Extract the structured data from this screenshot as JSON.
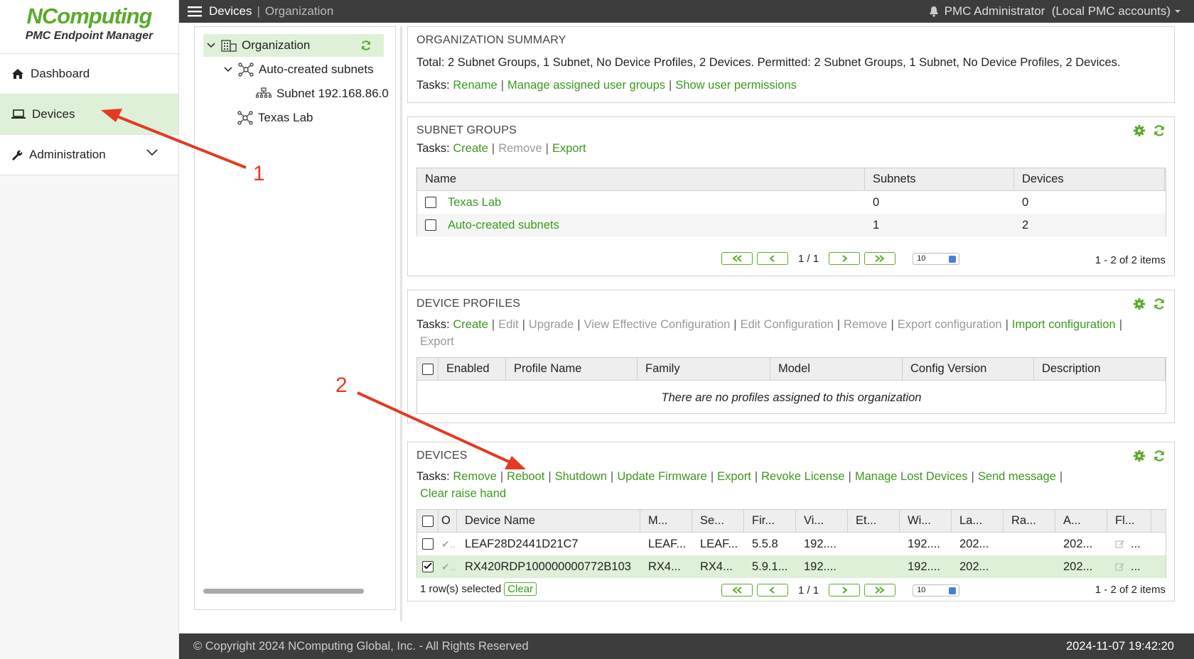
{
  "app": {
    "brand": "NComputing",
    "subtitle": "PMC Endpoint Manager"
  },
  "sidebar": {
    "items": [
      {
        "label": "Dashboard",
        "icon": "home-icon"
      },
      {
        "label": "Devices",
        "icon": "laptop-icon",
        "active": true
      },
      {
        "label": "Administration",
        "icon": "wrench-icon"
      }
    ]
  },
  "topbar": {
    "crumb_current": "Devices",
    "crumb_separator": "|",
    "crumb_next": "Organization",
    "user": "PMC Administrator",
    "user_scope": "(Local PMC accounts)"
  },
  "tree": {
    "root": "Organization",
    "child1": "Auto-created subnets",
    "child1_sub": "Subnet 192.168.86.0",
    "child2": "Texas Lab"
  },
  "org_summary": {
    "title": "ORGANIZATION SUMMARY",
    "total_text": "Total: 2 Subnet Groups, 1 Subnet, No Device Profiles, 2 Devices. Permitted: 2 Subnet Groups, 1 Subnet, No Device Profiles, 2 Devices.",
    "tasks_label": "Tasks:",
    "tasks": [
      "Rename",
      "Manage assigned user groups",
      "Show user permissions"
    ]
  },
  "subnet_groups": {
    "title": "SUBNET GROUPS",
    "tasks_label": "Tasks:",
    "tasks": [
      {
        "label": "Create",
        "enabled": true
      },
      {
        "label": "Remove",
        "enabled": false
      },
      {
        "label": "Export",
        "enabled": true
      }
    ],
    "columns": [
      "Name",
      "Subnets",
      "Devices"
    ],
    "rows": [
      {
        "name": "Texas Lab",
        "subnets": "0",
        "devices": "0"
      },
      {
        "name": "Auto-created subnets",
        "subnets": "1",
        "devices": "2"
      }
    ],
    "page": "1 / 1",
    "page_size": "10",
    "items": "1 - 2 of 2 items"
  },
  "device_profiles": {
    "title": "DEVICE PROFILES",
    "tasks_label": "Tasks:",
    "tasks": [
      {
        "label": "Create",
        "enabled": true
      },
      {
        "label": "Edit",
        "enabled": false
      },
      {
        "label": "Upgrade",
        "enabled": false
      },
      {
        "label": "View Effective Configuration",
        "enabled": false
      },
      {
        "label": "Edit Configuration",
        "enabled": false
      },
      {
        "label": "Remove",
        "enabled": false
      },
      {
        "label": "Export configuration",
        "enabled": false
      },
      {
        "label": "Import configuration",
        "enabled": true
      },
      {
        "label": "Export",
        "enabled": false
      }
    ],
    "columns": [
      "Enabled",
      "Profile Name",
      "Family",
      "Model",
      "Config Version",
      "Description"
    ],
    "empty_message": "There are no profiles assigned to this organization"
  },
  "devices": {
    "title": "DEVICES",
    "tasks_label": "Tasks:",
    "tasks": [
      "Remove",
      "Reboot",
      "Shutdown",
      "Update Firmware",
      "Export",
      "Revoke License",
      "Manage Lost Devices",
      "Send message",
      "Clear raise hand"
    ],
    "columns": [
      "O",
      "Device Name",
      "M...",
      "Se...",
      "Fir...",
      "Vi...",
      "Et...",
      "Wi...",
      "La...",
      "Ra...",
      "A...",
      "Fl..."
    ],
    "rows": [
      {
        "checked": false,
        "status": "✔..",
        "name": "LEAF28D2441D21C7",
        "m": "LEAF...",
        "se": "LEAF...",
        "fir": "5.5.8",
        "vi": "192....",
        "et": "",
        "wi": "192....",
        "la": "202...",
        "ra": "",
        "a": "202...",
        "fl": "..."
      },
      {
        "checked": true,
        "status": "✔..",
        "name": "RX420RDP100000000772B103",
        "m": "RX4...",
        "se": "RX4...",
        "fir": "5.9.1...",
        "vi": "192....",
        "et": "",
        "wi": "192....",
        "la": "202...",
        "ra": "",
        "a": "202...",
        "fl": "..."
      }
    ],
    "selected_text": "1 row(s) selected",
    "clear_label": "Clear",
    "page": "1 / 1",
    "page_size": "10",
    "items": "1 - 2 of 2 items"
  },
  "footer": {
    "copyright": "© Copyright 2024 NComputing Global, Inc. - All Rights Reserved",
    "timestamp": "2024-11-07 19:42:20"
  },
  "annotations": {
    "label1": "1",
    "label2": "2",
    "color": "#e33a22"
  }
}
